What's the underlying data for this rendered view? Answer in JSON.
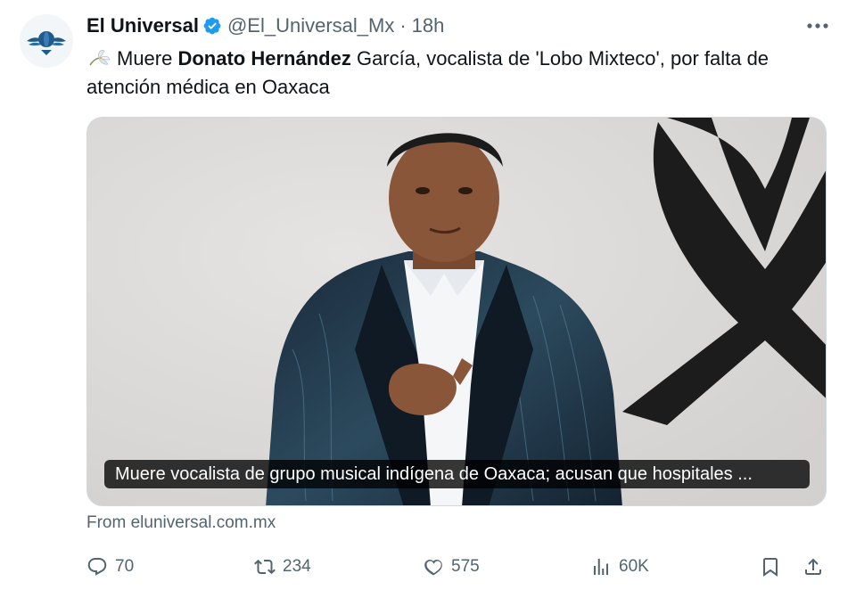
{
  "tweet": {
    "author_name": "El Universal",
    "handle": "@El_Universal_Mx",
    "separator": "·",
    "time": "18h",
    "text_lead": "Muere ",
    "text_bold": "Donato Hernández",
    "text_rest": " García, vocalista de 'Lobo Mixteco', por falta de atención médica en Oaxaca"
  },
  "card": {
    "caption": "Muere vocalista de grupo musical indígena de Oaxaca; acusan que hospitales ...",
    "source": "From eluniversal.com.mx"
  },
  "stats": {
    "replies": "70",
    "reposts": "234",
    "likes": "575",
    "views": "60K"
  },
  "icons": {
    "verified": "verified-badge-icon",
    "more": "more-icon",
    "reply": "reply-icon",
    "repost": "repost-icon",
    "like": "heart-icon",
    "views": "views-icon",
    "bookmark": "bookmark-icon",
    "share": "share-icon"
  },
  "colors": {
    "verified_blue": "#1d9bf0",
    "secondary_text": "#536471",
    "primary_text": "#0f1419"
  }
}
